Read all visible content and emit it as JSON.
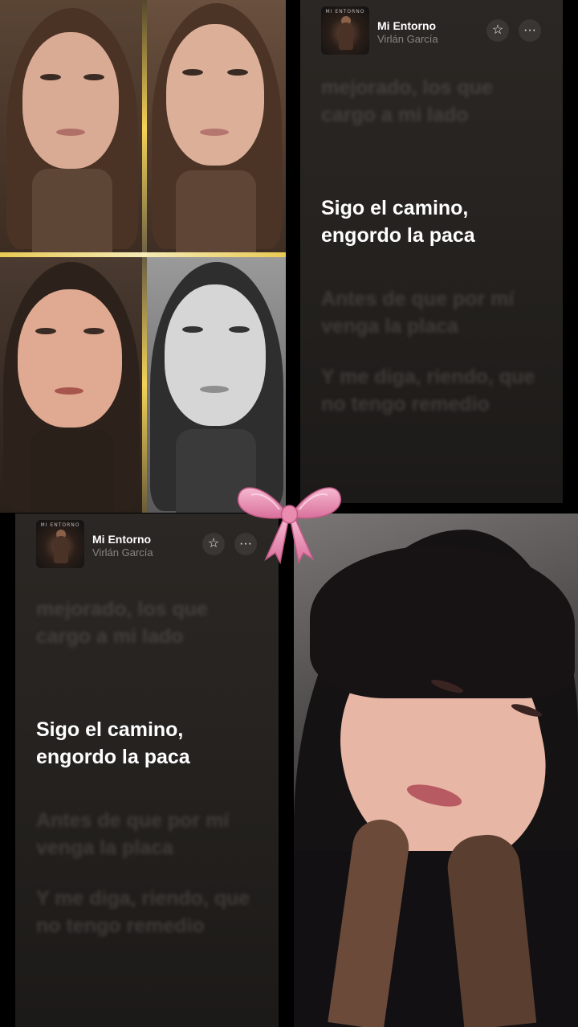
{
  "lyrics_cards": [
    {
      "song_title": "Mi Entorno",
      "artist": "Virlán García",
      "album_art_text": "MI ENTORNO",
      "more_label": "···",
      "lyrics": {
        "prev": "mejorado, los que cargo a mi lado",
        "current": "Sigo el camino, engordo la paca",
        "next1": "Antes de que por mí venga la placa",
        "next2": "Y me diga, riendo, que no tengo remedio"
      }
    },
    {
      "song_title": "Mi Entorno",
      "artist": "Virlán García",
      "album_art_text": "MI ENTORNO",
      "more_label": "···",
      "lyrics": {
        "prev": "mejorado, los que cargo a mi lado",
        "current": "Sigo el camino, engordo la paca",
        "next1": "Antes de que por mí venga la placa",
        "next2": "Y me diga, riendo, que no tengo remedio"
      }
    }
  ],
  "icons": {
    "favorite": "star-icon",
    "more": "more-horizontal-icon",
    "decoration": "pink-bow-icon"
  },
  "colors": {
    "lyric_active": "#ffffff",
    "lyric_dim": "#78726c",
    "bow_pink": "#e98cb0",
    "collage_glow": "#ffd95a"
  }
}
